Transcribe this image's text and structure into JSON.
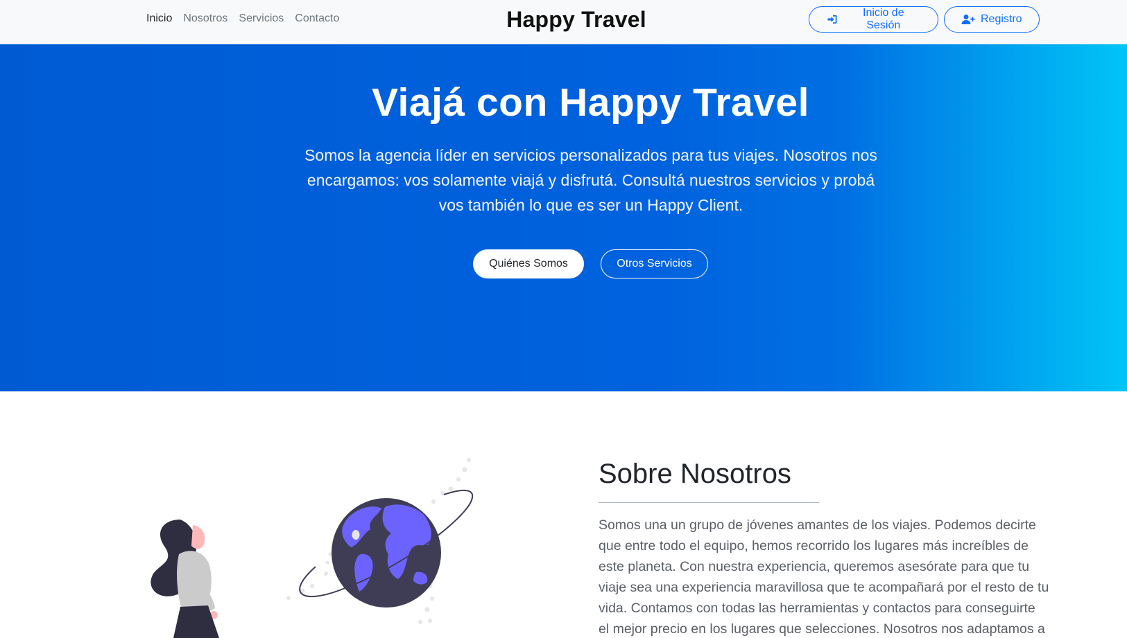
{
  "nav": {
    "links": [
      {
        "label": "Inicio"
      },
      {
        "label": "Nosotros"
      },
      {
        "label": "Servicios"
      },
      {
        "label": "Contacto"
      }
    ],
    "brand": "Happy Travel",
    "login_label": "Inicio de Sesión",
    "register_label": "Registro"
  },
  "hero": {
    "title": "Viajá con Happy Travel",
    "text": "Somos la agencia líder en servicios personalizados para tus viajes. Nosotros nos encargamos: vos solamente viajá y disfrutá. Consultá nuestros servicios y probá vos también lo que es ser un Happy Client.",
    "primary_button": "Quiénes Somos",
    "secondary_button": "Otros Servicios"
  },
  "about": {
    "title_light": "Sobre",
    "title_bold": "Nosotros",
    "text": "Somos una un grupo de jóvenes amantes de los viajes. Podemos decirte que entre todo el equipo, hemos recorrido los lugares más increíbles de este planeta. Con nuestra experiencia, queremos asesórate para que tu viaje sea una experiencia maravillosa que te acompañará por el resto de tu vida. Contamos con todas las herramientas y contactos para conseguirte el mejor precio en los lugares que selecciones. Nosotros nos adaptamos a tus"
  },
  "colors": {
    "primary": "#0d6efd",
    "hero_start": "#005bd3",
    "hero_end": "#00c5f7",
    "planet": "#3f3d56",
    "continents": "#6c63ff"
  },
  "icons": {
    "login": "sign-in-icon",
    "register": "user-plus-icon"
  }
}
